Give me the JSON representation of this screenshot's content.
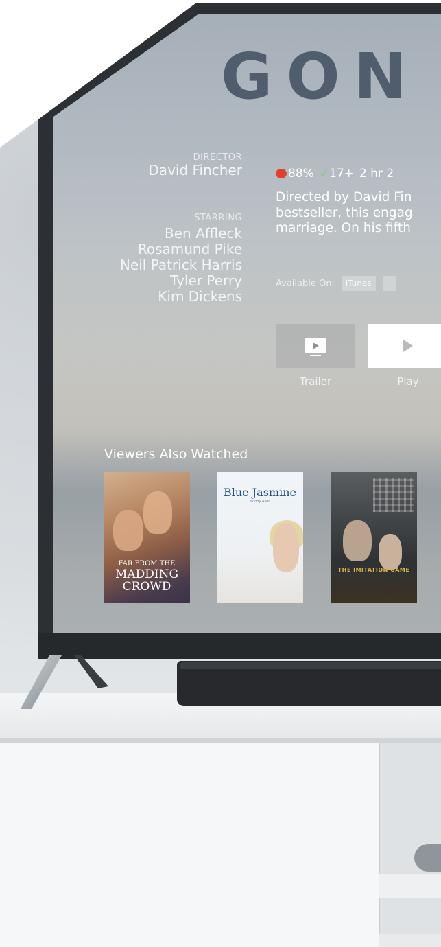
{
  "movie": {
    "title": "GON",
    "director_label": "DIRECTOR",
    "director": "David Fincher",
    "starring_label": "STARRING",
    "cast": [
      "Ben Affleck",
      "Rosamund Pike",
      "Neil Patrick Harris",
      "Tyler Perry",
      "Kim Dickens"
    ],
    "rating_score": "88%",
    "age_rating": "17+",
    "runtime": "2 hr 2",
    "description_lines": [
      "Directed by David Fin",
      "bestseller, this engag",
      "marriage. On his fifth"
    ]
  },
  "availability": {
    "label": "Available On:",
    "services": [
      "iTunes"
    ]
  },
  "actions": {
    "trailer_label": "Trailer",
    "play_label": "Play"
  },
  "related": {
    "title": "Viewers Also Watched",
    "posters": [
      {
        "title_line1": "FAR FROM THE",
        "title_line2": "MADDING",
        "title_line3": "CROWD"
      },
      {
        "title": "Blue Jasmine",
        "subtitle": "Woody Allen"
      },
      {
        "title": "THE IMITATION GAME"
      }
    ]
  },
  "icons": {
    "rating": "tomato-icon",
    "age": "check-icon",
    "trailer": "screen-play-icon",
    "play": "play-icon"
  },
  "colors": {
    "title": "#4f5d6d",
    "tomato": "#e2402e",
    "check": "#7fc96a"
  }
}
